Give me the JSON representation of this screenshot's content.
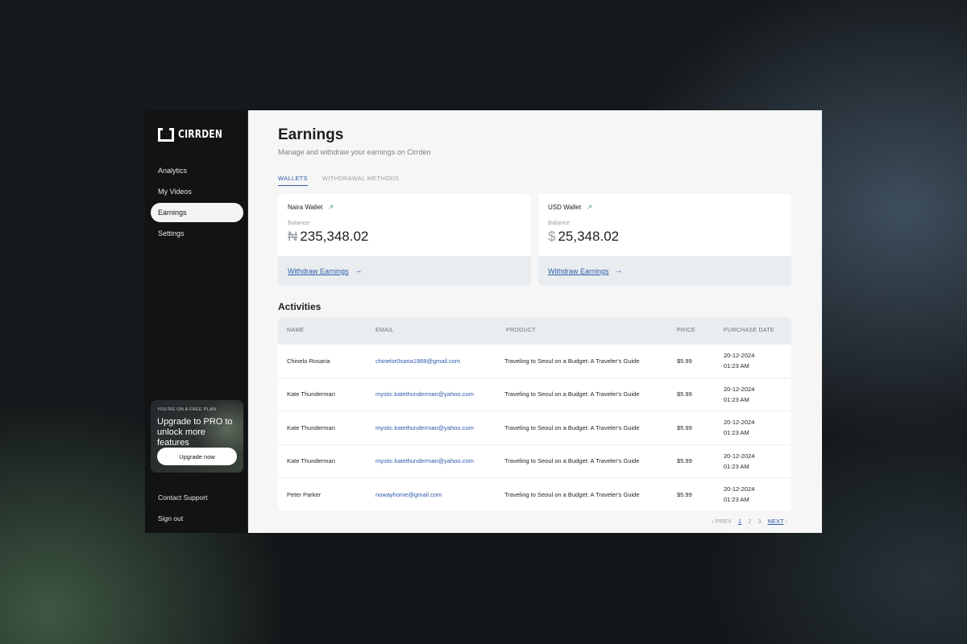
{
  "brand": {
    "name": "CIRRDEN",
    "icon": "cirrden-logo-icon"
  },
  "sidebar": {
    "items": [
      {
        "label": "Analytics",
        "active": false
      },
      {
        "label": "My Videos",
        "active": false
      },
      {
        "label": "Earnings",
        "active": true
      },
      {
        "label": "Settings",
        "active": false
      }
    ],
    "promo": {
      "kicker": "YOU'RE ON A FREE PLAN",
      "title": "Upgrade to PRO to unlock more features",
      "button": "Upgrade now"
    },
    "footer": {
      "support": "Contact Support",
      "signout": "Sign out"
    }
  },
  "header": {
    "title": "Earnings",
    "subtitle": "Manage and withdraw your earnings on Cirrden"
  },
  "tabs": [
    {
      "label": "WALLETS",
      "active": true
    },
    {
      "label": "WITHDRAWAL METHODS",
      "active": false
    }
  ],
  "wallets": [
    {
      "name": "Naira Wallet",
      "icon": "arrow-up-right-icon",
      "balance_label": "Balance",
      "currency_symbol": "₦",
      "amount": "235,348.02",
      "action": "Withdraw Earnings"
    },
    {
      "name": "USD Wallet",
      "icon": "arrow-up-right-icon",
      "balance_label": "Balance",
      "currency_symbol": "$",
      "amount": "25,348.02",
      "action": "Withdraw Earnings"
    }
  ],
  "activities": {
    "title": "Activities",
    "columns": [
      "NAME",
      "EMAIL",
      "PRODUCT",
      "PRICE",
      "PURCHASE DATE"
    ],
    "rows": [
      {
        "name": "Chinelo Rosaria",
        "email": "chinelor0saria1988@gmail.com",
        "product": "Traveling to Seoul on a Budget: A Traveler's Guide",
        "price": "$5.99",
        "date": "20-12-2024",
        "time": "01:23 AM"
      },
      {
        "name": "Kate Thunderman",
        "email": "mystic.katethunderman@yahoo.com",
        "product": "Traveling to Seoul on a Budget: A Traveler's Guide",
        "price": "$5.99",
        "date": "20-12-2024",
        "time": "01:23 AM"
      },
      {
        "name": "Kate Thunderman",
        "email": "mystic.katethunderman@yahoo.com",
        "product": "Traveling to Seoul on a Budget: A Traveler's Guide",
        "price": "$5.99",
        "date": "20-12-2024",
        "time": "01:23 AM"
      },
      {
        "name": "Kate Thunderman",
        "email": "mystic.katethunderman@yahoo.com",
        "product": "Traveling to Seoul on a Budget: A Traveler's Guide",
        "price": "$5.99",
        "date": "20-12-2024",
        "time": "01:23 AM"
      },
      {
        "name": "Peter Parker",
        "email": "nowayhome@gmail.com",
        "product": "Traveling to Seoul on a Budget: A Traveler's Guide",
        "price": "$5.99",
        "date": "20-12-2024",
        "time": "01:23 AM"
      }
    ]
  },
  "pagination": {
    "prev": "PREV",
    "pages": [
      "1",
      "2",
      "3"
    ],
    "current": "1",
    "next": "NEXT"
  },
  "colors": {
    "accent": "#2f5aa8",
    "sidebar_bg": "#111315",
    "main_bg": "#f6f6f6"
  }
}
